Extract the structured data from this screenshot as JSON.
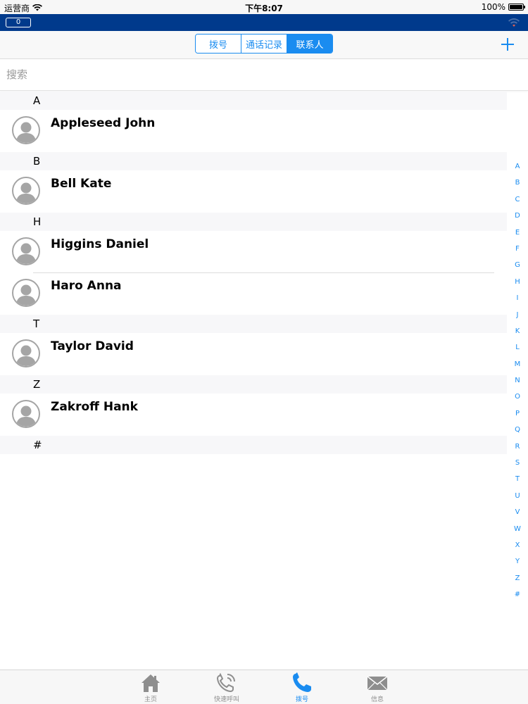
{
  "status_bar": {
    "carrier": "运营商",
    "time": "下午8:07",
    "battery": "100%",
    "battery_level": 1.0
  },
  "app_bar": {
    "counter": "0"
  },
  "nav": {
    "segments": [
      {
        "label": "拨号",
        "active": false
      },
      {
        "label": "通话记录",
        "active": false
      },
      {
        "label": "联系人",
        "active": true
      }
    ]
  },
  "search": {
    "placeholder": "搜索"
  },
  "contacts": {
    "sections": [
      {
        "letter": "A",
        "names": [
          "Appleseed John"
        ]
      },
      {
        "letter": "B",
        "names": [
          "Bell Kate"
        ]
      },
      {
        "letter": "H",
        "names": [
          "Higgins Daniel",
          "Haro Anna"
        ]
      },
      {
        "letter": "T",
        "names": [
          "Taylor David"
        ]
      },
      {
        "letter": "Z",
        "names": [
          "Zakroff Hank"
        ]
      },
      {
        "letter": "#",
        "names": []
      }
    ]
  },
  "index_letters": [
    "A",
    "B",
    "C",
    "D",
    "E",
    "F",
    "G",
    "H",
    "I",
    "J",
    "K",
    "L",
    "M",
    "N",
    "O",
    "P",
    "Q",
    "R",
    "S",
    "T",
    "U",
    "V",
    "W",
    "X",
    "Y",
    "Z",
    "#"
  ],
  "tabs": [
    {
      "label": "主页",
      "icon": "home-icon",
      "active": false
    },
    {
      "label": "快速呼叫",
      "icon": "speed-dial-icon",
      "active": false
    },
    {
      "label": "拨号",
      "icon": "phone-icon",
      "active": true
    },
    {
      "label": "信息",
      "icon": "message-icon",
      "active": false
    }
  ],
  "colors": {
    "accent": "#1a8cf0",
    "app_bar": "#003a8c",
    "inactive": "#8e8e8e"
  }
}
